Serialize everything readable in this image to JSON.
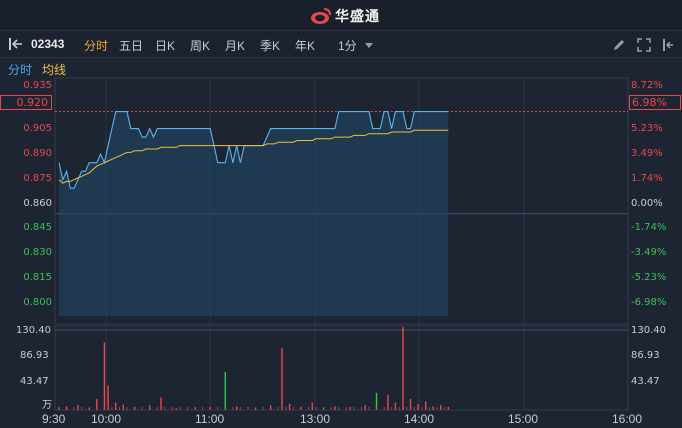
{
  "header": {
    "brand": "华盛通"
  },
  "toolbar": {
    "stock_code": "02343",
    "tabs": [
      "分时",
      "五日",
      "日K",
      "周K",
      "月K",
      "季K",
      "年K"
    ],
    "active_tab": "分时",
    "interval": "1分",
    "icons": [
      "back-icon",
      "pencil-icon",
      "expand-icon",
      "settings-icon"
    ]
  },
  "legend": {
    "minute_line": "分时",
    "avg_line": "均线"
  },
  "price_axis": {
    "left_labels": [
      "0.935",
      "0.905",
      "0.890",
      "0.875",
      "0.860",
      "0.845",
      "0.830",
      "0.815",
      "0.800"
    ],
    "right_labels": [
      "8.72%",
      "5.23%",
      "3.49%",
      "1.74%",
      "0.00%",
      "-1.74%",
      "-3.49%",
      "-5.23%",
      "-6.98%"
    ],
    "current_price": "0.920",
    "current_pct": "6.98%"
  },
  "volume_axis": {
    "labels": [
      "130.40",
      "86.93",
      "43.47"
    ],
    "unit": "万"
  },
  "time_axis": [
    "9:30",
    "10:00",
    "11:00",
    "13:00",
    "14:00",
    "15:00",
    "16:00"
  ],
  "colors": {
    "price_line": "#5ab4f0",
    "avg_line": "#f0c040",
    "up": "#e8484c",
    "down": "#3cbf5a",
    "area_fill": "#1f4a6a"
  },
  "chart_data": {
    "type": "line",
    "prev_close": 0.86,
    "ylim": [
      0.8,
      0.935
    ],
    "series": [
      {
        "name": "分时",
        "values": [
          0.89,
          0.88,
          0.885,
          0.875,
          0.875,
          0.88,
          0.885,
          0.885,
          0.89,
          0.89,
          0.89,
          0.895,
          0.89,
          0.9,
          0.91,
          0.92,
          0.92,
          0.92,
          0.92,
          0.91,
          0.91,
          0.91,
          0.905,
          0.905,
          0.91,
          0.905,
          0.91,
          0.91,
          0.91,
          0.91,
          0.91,
          0.91,
          0.91,
          0.91,
          0.91,
          0.91,
          0.91,
          0.91,
          0.91,
          0.91,
          0.91,
          0.9,
          0.89,
          0.89,
          0.89,
          0.9,
          0.89,
          0.9,
          0.89,
          0.9,
          0.9,
          0.9,
          0.9,
          0.9,
          0.9,
          0.905,
          0.91,
          0.91,
          0.91,
          0.91,
          0.91,
          0.91,
          0.91,
          0.91,
          0.91,
          0.91,
          0.91,
          0.91,
          0.91,
          0.91,
          0.91,
          0.91,
          0.91,
          0.91,
          0.92,
          0.92,
          0.92,
          0.92,
          0.92,
          0.92,
          0.92,
          0.92,
          0.92,
          0.91,
          0.91,
          0.91,
          0.92,
          0.92,
          0.91,
          0.92,
          0.92,
          0.92,
          0.91,
          0.91,
          0.92,
          0.92,
          0.92,
          0.92,
          0.92,
          0.92,
          0.92,
          0.92,
          0.92,
          0.92
        ]
      },
      {
        "name": "均线",
        "values": [
          0.88,
          0.878,
          0.879,
          0.879,
          0.88,
          0.881,
          0.882,
          0.883,
          0.884,
          0.886,
          0.888,
          0.889,
          0.89,
          0.891,
          0.892,
          0.893,
          0.894,
          0.895,
          0.896,
          0.896,
          0.897,
          0.897,
          0.897,
          0.898,
          0.898,
          0.898,
          0.898,
          0.899,
          0.899,
          0.899,
          0.899,
          0.899,
          0.9,
          0.9,
          0.9,
          0.9,
          0.9,
          0.9,
          0.9,
          0.9,
          0.9,
          0.9,
          0.9,
          0.9,
          0.9,
          0.9,
          0.9,
          0.9,
          0.9,
          0.9,
          0.9,
          0.9,
          0.9,
          0.9,
          0.9,
          0.901,
          0.901,
          0.901,
          0.902,
          0.902,
          0.902,
          0.902,
          0.902,
          0.903,
          0.903,
          0.903,
          0.903,
          0.903,
          0.904,
          0.904,
          0.904,
          0.904,
          0.904,
          0.905,
          0.905,
          0.905,
          0.905,
          0.905,
          0.906,
          0.906,
          0.906,
          0.906,
          0.907,
          0.907,
          0.907,
          0.907,
          0.907,
          0.907,
          0.908,
          0.908,
          0.908,
          0.908,
          0.908,
          0.908,
          0.909,
          0.909,
          0.909,
          0.909,
          0.909,
          0.909,
          0.909,
          0.909,
          0.909,
          0.909
        ]
      }
    ],
    "volume_max": 130.4,
    "volumes": [
      {
        "i": 0,
        "v": 4,
        "dir": "up"
      },
      {
        "i": 2,
        "v": 6,
        "dir": "up"
      },
      {
        "i": 5,
        "v": 8,
        "dir": "up"
      },
      {
        "i": 8,
        "v": 3,
        "dir": "up"
      },
      {
        "i": 10,
        "v": 18,
        "dir": "up"
      },
      {
        "i": 12,
        "v": 110,
        "dir": "up"
      },
      {
        "i": 13,
        "v": 40,
        "dir": "up"
      },
      {
        "i": 15,
        "v": 12,
        "dir": "up"
      },
      {
        "i": 17,
        "v": 9,
        "dir": "up"
      },
      {
        "i": 20,
        "v": 5,
        "dir": "up"
      },
      {
        "i": 24,
        "v": 8,
        "dir": "up"
      },
      {
        "i": 27,
        "v": 20,
        "dir": "up"
      },
      {
        "i": 31,
        "v": 3,
        "dir": "up"
      },
      {
        "i": 36,
        "v": 4,
        "dir": "up"
      },
      {
        "i": 40,
        "v": 5,
        "dir": "up"
      },
      {
        "i": 44,
        "v": 62,
        "dir": "down"
      },
      {
        "i": 47,
        "v": 6,
        "dir": "up"
      },
      {
        "i": 52,
        "v": 3,
        "dir": "up"
      },
      {
        "i": 56,
        "v": 8,
        "dir": "up"
      },
      {
        "i": 59,
        "v": 101,
        "dir": "up"
      },
      {
        "i": 61,
        "v": 10,
        "dir": "up"
      },
      {
        "i": 64,
        "v": 5,
        "dir": "up"
      },
      {
        "i": 67,
        "v": 12,
        "dir": "up"
      },
      {
        "i": 70,
        "v": 4,
        "dir": "up"
      },
      {
        "i": 73,
        "v": 6,
        "dir": "up"
      },
      {
        "i": 77,
        "v": 5,
        "dir": "up"
      },
      {
        "i": 81,
        "v": 8,
        "dir": "up"
      },
      {
        "i": 84,
        "v": 28,
        "dir": "down"
      },
      {
        "i": 87,
        "v": 25,
        "dir": "up"
      },
      {
        "i": 89,
        "v": 12,
        "dir": "up"
      },
      {
        "i": 91,
        "v": 135,
        "dir": "up"
      },
      {
        "i": 93,
        "v": 18,
        "dir": "up"
      },
      {
        "i": 95,
        "v": 10,
        "dir": "up"
      },
      {
        "i": 97,
        "v": 14,
        "dir": "up"
      },
      {
        "i": 99,
        "v": 6,
        "dir": "up"
      },
      {
        "i": 101,
        "v": 8,
        "dir": "up"
      },
      {
        "i": 103,
        "v": 5,
        "dir": "up"
      }
    ]
  }
}
